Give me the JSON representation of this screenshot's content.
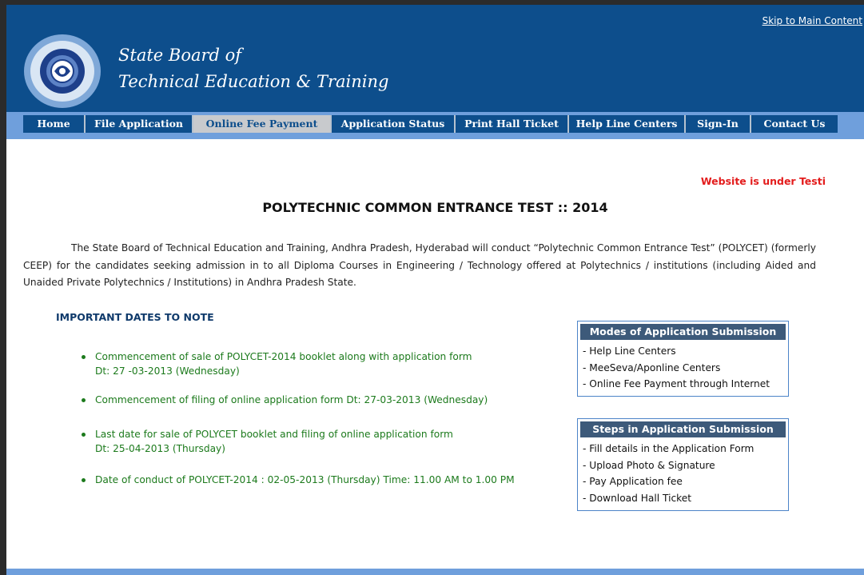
{
  "header": {
    "skip_link": "Skip to Main Content",
    "title_line1": "State Board of",
    "title_line2": "Technical Education & Training",
    "logo_icon": "sbtet-emblem-icon"
  },
  "nav": {
    "items": [
      {
        "label": "Home",
        "active": false
      },
      {
        "label": "File Application",
        "active": false
      },
      {
        "label": "Online Fee Payment",
        "active": true
      },
      {
        "label": "Application Status",
        "active": false
      },
      {
        "label": "Print Hall Ticket",
        "active": false
      },
      {
        "label": "Help Line Centers",
        "active": false
      },
      {
        "label": "Sign-In",
        "active": false
      },
      {
        "label": "Contact Us",
        "active": false
      }
    ]
  },
  "main": {
    "notice": "Website is under Testi",
    "title": "POLYTECHNIC COMMON ENTRANCE TEST :: 2014",
    "intro": "The State Board of Technical Education and Training, Andhra Pradesh, Hyderabad will conduct “Polytechnic Common Entrance Test” (POLYCET) (formerly CEEP) for the candidates seeking admission in to all Diploma Courses in Engineering / Technology offered at Polytechnics / institutions (including Aided and Unaided Private Polytechnics / Institutions) in Andhra Pradesh State.",
    "dates_heading": "IMPORTANT DATES TO NOTE",
    "dates": [
      {
        "line1": "Commencement of sale of POLYCET-2014 booklet along with application form",
        "line2": "Dt: 27 -03-2013 (Wednesday)"
      },
      {
        "line1": "Commencement of filing of online application form  Dt: 27-03-2013 (Wednesday)",
        "line2": ""
      },
      {
        "line1": "Last date for sale of POLYCET booklet and filing of online application form",
        "line2": "Dt: 25-04-2013 (Thursday)"
      },
      {
        "line1": "Date of conduct of POLYCET-2014 : 02-05-2013 (Thursday) Time: 11.00 AM to 1.00 PM",
        "line2": ""
      }
    ]
  },
  "modes_box": {
    "title": "Modes of Application Submission",
    "items": [
      "- Help Line Centers",
      "- MeeSeva/Aponline Centers",
      "- Online Fee Payment through Internet"
    ]
  },
  "steps_box": {
    "title": "Steps in Application Submission",
    "items": [
      "- Fill details in the Application Form",
      "- Upload Photo & Signature",
      "- Pay Application fee",
      "- Download Hall Ticket"
    ]
  },
  "colors": {
    "header_blue": "#0d4e8c",
    "nav_light": "#6f9fdc",
    "notice_red": "#e31c1c",
    "date_green": "#1c7a1c"
  }
}
